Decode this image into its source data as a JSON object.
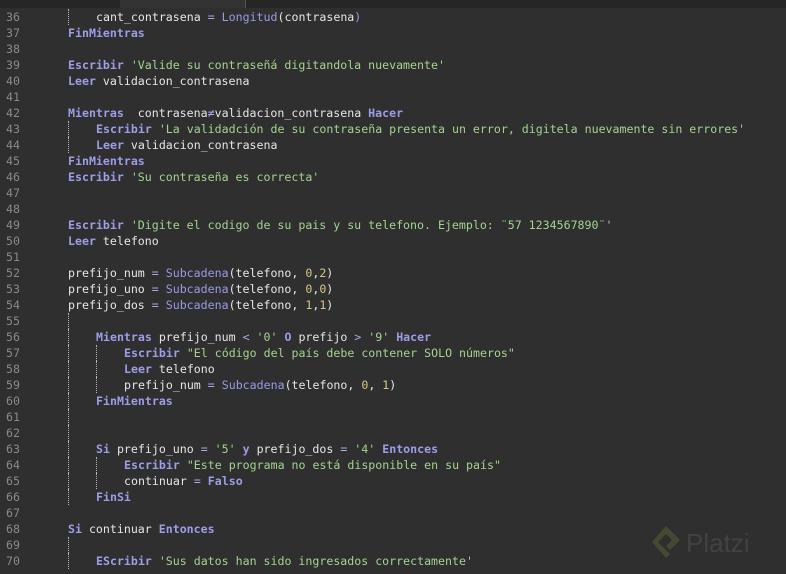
{
  "watermark": "Platzi",
  "lines": [
    {
      "n": "36",
      "i": 2,
      "g": 1,
      "tk": [
        [
          "t",
          "cant_contrasena "
        ],
        [
          "o",
          "="
        ],
        [
          "t",
          " "
        ],
        [
          "f",
          "Longitud"
        ],
        [
          "t",
          "(contrasena"
        ],
        [
          "f",
          ")"
        ]
      ]
    },
    {
      "n": "37",
      "i": 1,
      "tk": [
        [
          "k",
          "FinMientras"
        ]
      ]
    },
    {
      "n": "38",
      "i": 0,
      "tk": []
    },
    {
      "n": "39",
      "i": 1,
      "tk": [
        [
          "k",
          "Escribir"
        ],
        [
          "s",
          " 'Valide su contraseñá digitandola nuevamente'"
        ]
      ]
    },
    {
      "n": "40",
      "i": 1,
      "tk": [
        [
          "k",
          "Leer"
        ],
        [
          "t",
          " validacion_contrasena"
        ]
      ]
    },
    {
      "n": "41",
      "i": 0,
      "tk": []
    },
    {
      "n": "42",
      "i": 1,
      "tk": [
        [
          "k",
          "Mientras"
        ],
        [
          "t",
          "  contrasena"
        ],
        [
          "o",
          "≠"
        ],
        [
          "t",
          "validacion_contrasena "
        ],
        [
          "k",
          "Hacer"
        ]
      ]
    },
    {
      "n": "43",
      "i": 2,
      "g": 1,
      "tk": [
        [
          "k",
          "Escribir"
        ],
        [
          "s",
          " 'La validadción de su contraseña presenta un error, digitela nuevamente sin errores'"
        ]
      ]
    },
    {
      "n": "44",
      "i": 2,
      "g": 1,
      "tk": [
        [
          "k",
          "Leer"
        ],
        [
          "t",
          " validacion_contrasena"
        ]
      ]
    },
    {
      "n": "45",
      "i": 1,
      "tk": [
        [
          "k",
          "FinMientras"
        ]
      ]
    },
    {
      "n": "46",
      "i": 1,
      "tk": [
        [
          "k",
          "Escribir"
        ],
        [
          "s",
          " 'Su contraseña es correcta'"
        ]
      ]
    },
    {
      "n": "47",
      "i": 0,
      "tk": []
    },
    {
      "n": "48",
      "i": 0,
      "tk": []
    },
    {
      "n": "49",
      "i": 1,
      "tk": [
        [
          "k",
          "Escribir"
        ],
        [
          "s",
          " 'Digite el codigo de su pais y su telefono. Ejemplo: ¨57 1234567890¨'"
        ]
      ]
    },
    {
      "n": "50",
      "i": 1,
      "tk": [
        [
          "k",
          "Leer"
        ],
        [
          "t",
          " telefono"
        ]
      ]
    },
    {
      "n": "51",
      "i": 0,
      "tk": []
    },
    {
      "n": "52",
      "i": 1,
      "tk": [
        [
          "t",
          "prefijo_num "
        ],
        [
          "o",
          "="
        ],
        [
          "t",
          " "
        ],
        [
          "f",
          "Subcadena"
        ],
        [
          "t",
          "(telefono, "
        ],
        [
          "n",
          "0"
        ],
        [
          "t",
          ","
        ],
        [
          "n",
          "2"
        ],
        [
          "t",
          ")"
        ]
      ]
    },
    {
      "n": "53",
      "i": 1,
      "tk": [
        [
          "t",
          "prefijo_uno "
        ],
        [
          "o",
          "="
        ],
        [
          "t",
          " "
        ],
        [
          "f",
          "Subcadena"
        ],
        [
          "t",
          "(telefono, "
        ],
        [
          "n",
          "0"
        ],
        [
          "t",
          ","
        ],
        [
          "n",
          "0"
        ],
        [
          "t",
          ")"
        ]
      ]
    },
    {
      "n": "54",
      "i": 1,
      "tk": [
        [
          "t",
          "prefijo_dos "
        ],
        [
          "o",
          "="
        ],
        [
          "t",
          " "
        ],
        [
          "f",
          "Subcadena"
        ],
        [
          "t",
          "(telefono, "
        ],
        [
          "n",
          "1"
        ],
        [
          "t",
          ","
        ],
        [
          "n",
          "1"
        ],
        [
          "t",
          ")"
        ]
      ]
    },
    {
      "n": "55",
      "i": 0,
      "g": 1,
      "tk": []
    },
    {
      "n": "56",
      "i": 2,
      "g": 1,
      "tk": [
        [
          "k",
          "Mientras"
        ],
        [
          "t",
          " prefijo_num "
        ],
        [
          "o",
          "<"
        ],
        [
          "s",
          " '0'"
        ],
        [
          "t",
          " "
        ],
        [
          "k",
          "O"
        ],
        [
          "t",
          " prefijo "
        ],
        [
          "o",
          ">"
        ],
        [
          "s",
          " '9'"
        ],
        [
          "t",
          " "
        ],
        [
          "k",
          "Hacer"
        ]
      ]
    },
    {
      "n": "57",
      "i": 3,
      "g": 2,
      "tk": [
        [
          "k",
          "Escribir"
        ],
        [
          "s",
          " \"El código del país debe contener SOLO números\""
        ]
      ]
    },
    {
      "n": "58",
      "i": 3,
      "g": 2,
      "tk": [
        [
          "k",
          "Leer"
        ],
        [
          "t",
          " telefono"
        ]
      ]
    },
    {
      "n": "59",
      "i": 3,
      "g": 2,
      "tk": [
        [
          "t",
          "prefijo_num "
        ],
        [
          "o",
          "="
        ],
        [
          "t",
          " "
        ],
        [
          "f",
          "Subcadena"
        ],
        [
          "t",
          "(telefono, "
        ],
        [
          "n",
          "0"
        ],
        [
          "t",
          ", "
        ],
        [
          "n",
          "1"
        ],
        [
          "t",
          ")"
        ]
      ]
    },
    {
      "n": "60",
      "i": 2,
      "g": 1,
      "tk": [
        [
          "k",
          "FinMientras"
        ]
      ]
    },
    {
      "n": "61",
      "i": 0,
      "g": 1,
      "tk": []
    },
    {
      "n": "62",
      "i": 0,
      "g": 1,
      "tk": []
    },
    {
      "n": "63",
      "i": 2,
      "g": 1,
      "tk": [
        [
          "k",
          "Si"
        ],
        [
          "t",
          " prefijo_uno "
        ],
        [
          "o",
          "="
        ],
        [
          "s",
          " '5'"
        ],
        [
          "t",
          " "
        ],
        [
          "k",
          "y"
        ],
        [
          "t",
          " prefijo_dos "
        ],
        [
          "o",
          "="
        ],
        [
          "s",
          " '4'"
        ],
        [
          "t",
          " "
        ],
        [
          "k",
          "Entonces"
        ]
      ]
    },
    {
      "n": "64",
      "i": 3,
      "g": 2,
      "tk": [
        [
          "k",
          "Escribir"
        ],
        [
          "s",
          " \"Este programa no está disponible en su país\""
        ]
      ]
    },
    {
      "n": "65",
      "i": 3,
      "g": 2,
      "tk": [
        [
          "t",
          "continuar "
        ],
        [
          "o",
          "="
        ],
        [
          "t",
          " "
        ],
        [
          "k",
          "Falso"
        ]
      ]
    },
    {
      "n": "66",
      "i": 2,
      "g": 1,
      "tk": [
        [
          "k",
          "FinSi"
        ]
      ]
    },
    {
      "n": "67",
      "i": 0,
      "tk": []
    },
    {
      "n": "68",
      "i": 1,
      "tk": [
        [
          "k",
          "Si"
        ],
        [
          "t",
          " continuar "
        ],
        [
          "k",
          "Entonces"
        ]
      ]
    },
    {
      "n": "69",
      "i": 0,
      "g": 1,
      "tk": []
    },
    {
      "n": "70",
      "i": 2,
      "g": 1,
      "tk": [
        [
          "k",
          "EScribir"
        ],
        [
          "s",
          " 'Sus datos han sido ingresados correctamente'"
        ]
      ]
    }
  ]
}
